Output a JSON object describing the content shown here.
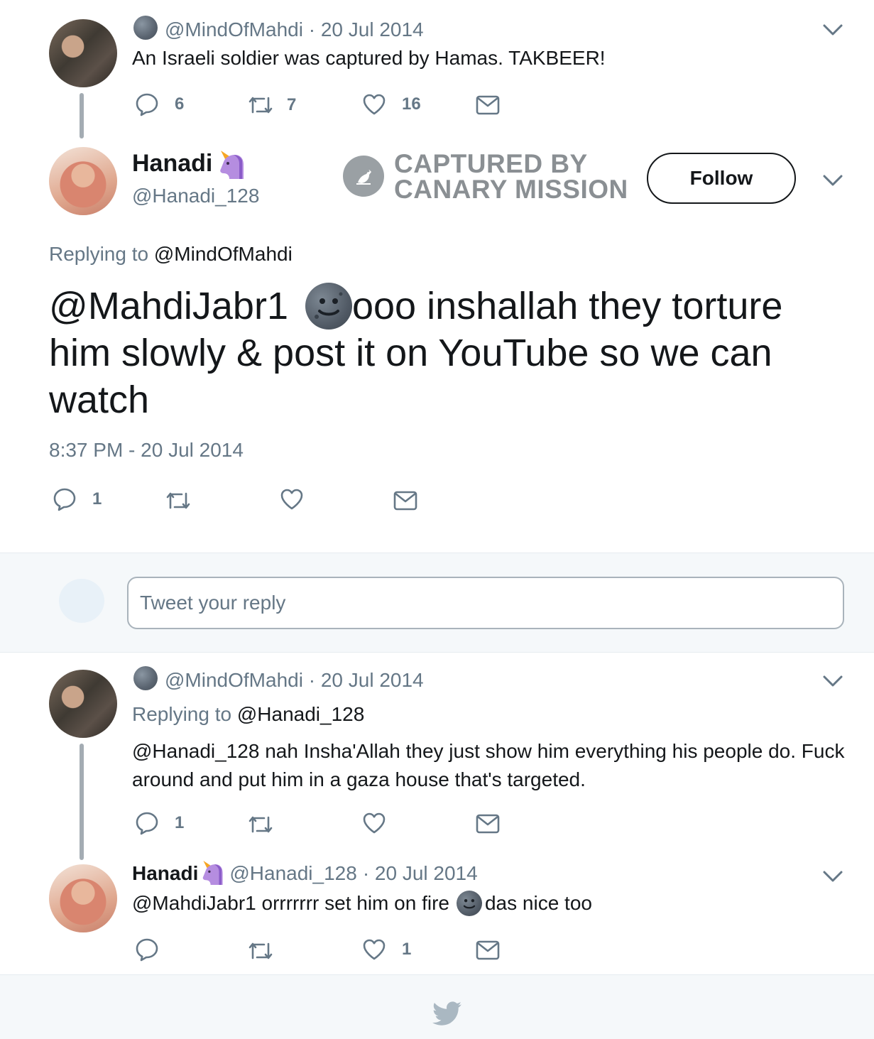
{
  "tweet1": {
    "handle": "@MindOfMahdi",
    "date": "· 20 Jul 2014",
    "text": "An Israeli soldier was captured by Hamas. TAKBEER!",
    "replies": "6",
    "retweets": "7",
    "likes": "16"
  },
  "main": {
    "name": "Hanadi",
    "handle": "@Hanadi_128",
    "follow_label": "Follow",
    "watermark_line1": "CAPTURED BY",
    "watermark_line2": "CANARY MISSION",
    "replying_label": "Replying to",
    "replying_to": "@MindOfMahdi",
    "text_mention": "@MahdiJabr1",
    "text_line1_rest": "ooo inshallah they torture",
    "text_line2": "him slowly & post it on YouTube so we can",
    "text_line3": "watch",
    "timestamp": "8:37 PM - 20 Jul 2014",
    "replies": "1"
  },
  "reply_box": {
    "placeholder": "Tweet your reply"
  },
  "tweet3": {
    "handle": "@MindOfMahdi",
    "date": "· 20 Jul 2014",
    "replying_label": "Replying to",
    "replying_to": "@Hanadi_128",
    "text_line1": "@Hanadi_128 nah Insha'Allah they just show him everything his people do. Fuck",
    "text_line2": "around and put him in a gaza house that's targeted.",
    "replies": "1"
  },
  "tweet4": {
    "name": "Hanadi",
    "handle": "@Hanadi_128",
    "date": "· 20 Jul 2014",
    "text_before": "@MahdiJabr1 orrrrrrr set him on fire",
    "text_after": "das nice too",
    "likes": "1"
  },
  "icons": {
    "reply": "reply-icon",
    "retweet": "retweet-icon",
    "like": "heart-icon",
    "dm": "envelope-icon",
    "caret": "chevron-down-icon",
    "footer": "twitter-bird-icon"
  },
  "colors": {
    "text": "#14171a",
    "muted": "#657786",
    "background_alt": "#f5f8fa",
    "bird": "#aab8c2"
  }
}
